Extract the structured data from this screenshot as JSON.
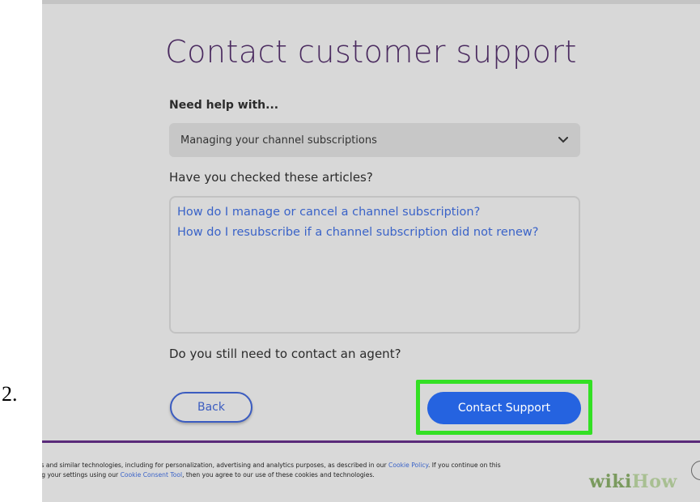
{
  "step": {
    "number": "2."
  },
  "page": {
    "title": "Contact customer support",
    "help_label": "Need help with...",
    "help_select": {
      "selected": "Managing your channel subscriptions"
    },
    "articles_label": "Have you checked these articles?",
    "articles": [
      "How do I manage or cancel a channel subscription?",
      "How do I resubscribe if a channel subscription did not renew?"
    ],
    "agent_question": "Do you still need to contact an agent?",
    "back_button": "Back",
    "contact_button": "Contact Support"
  },
  "cookie_banner": {
    "line1_pre": "ookies and similar technologies, including for personalization, advertising and analytics purposes, as described in our ",
    "line1_link": "Cookie Policy",
    "line1_post": ". If you continue on this",
    "line2_pre": "anging your settings using our ",
    "line2_link": "Cookie Consent Tool",
    "line2_post": ", then you agree to our use of these cookies and technologies."
  },
  "watermark": {
    "part1": "wiki",
    "part2": "How"
  },
  "colors": {
    "title": "#4a2a5f",
    "link": "#3a63c8",
    "primary_button": "#2563e0",
    "highlight": "#33e024",
    "divider": "#5a2b7a"
  },
  "icons": {
    "select_chevron": "chevron-down-icon",
    "banner_close": "close-icon"
  }
}
